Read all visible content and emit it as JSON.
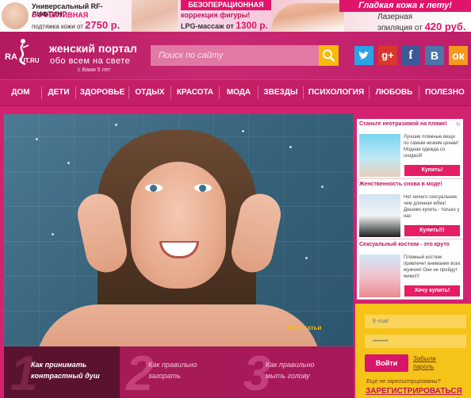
{
  "banners": [
    {
      "line1": "Универсальный RF-ЛИФТИНГ",
      "line2": "ЭФФЕКТИВНАЯ",
      "line3_prefix": "подтяжка кожи от",
      "price": "2750 р."
    },
    {
      "header": "БЕЗОПЕРАЦИОННАЯ",
      "line2": "коррекция фигуры!",
      "line3_prefix": "LPG-массаж от",
      "price": "1300 р."
    },
    {
      "header": "Гладкая кожа к лету!",
      "line2": "Лазерная",
      "line3_prefix": "эпиляция от",
      "price": "420 руб."
    }
  ],
  "header": {
    "logo_left": "RA",
    "logo_right": "UT.RU",
    "title": "женский портал",
    "subtitle": "обо всем на свете",
    "since": "с Вами 5 лет"
  },
  "search": {
    "placeholder": "Поиск по сайту"
  },
  "social": [
    {
      "name": "twitter",
      "glyph": ""
    },
    {
      "name": "google-plus",
      "glyph": "g+"
    },
    {
      "name": "facebook",
      "glyph": "f"
    },
    {
      "name": "vkontakte",
      "glyph": "B"
    },
    {
      "name": "odnoklassniki",
      "glyph": "ок"
    }
  ],
  "nav": [
    "ДОМ",
    "ДЕТИ",
    "ЗДОРОВЬЕ",
    "ОТДЫХ",
    "КРАСОТА",
    "МОДА",
    "ЗВЕЗДЫ",
    "ПСИХОЛОГИЯ",
    "ЛЮБОВЬ",
    "ПОЛЕЗНО"
  ],
  "hero": {
    "caption": "Все статьи"
  },
  "slider_tabs": [
    {
      "num": "1",
      "label": "Как принимать контрастный душ"
    },
    {
      "num": "2",
      "label": "Как правильно загорать"
    },
    {
      "num": "3",
      "label": "Как правильно мыть голову"
    }
  ],
  "ads": [
    {
      "title": "Станьте неотразимой на пляже!",
      "text": "Лучшие пляжные вещи по самым низким ценам! Модная одежда со скидкой!",
      "button": "Купить!"
    },
    {
      "title": "Женственность снова в моде!",
      "text": "Нет ничего сексуальнее, чем длинная юбка! Дешево купить - только у нас",
      "button": "Купить!!!"
    },
    {
      "title": "Сексуальный костюм - это круто",
      "text": "Пляжный костюм привлечет внимание всех мужчин! Они не пройдут мимо!!!",
      "button": "Хочу купить!"
    }
  ],
  "login": {
    "email_placeholder": "E-mail",
    "password_placeholder": "••••••••",
    "button": "Войти",
    "forgot": "Забыли пароль",
    "no_reg": "Еще не зарегистрированы?",
    "register": "ЗАРЕГИСТРИРОВАТЬСЯ"
  },
  "colors": {
    "brand": "#c41e66",
    "accent": "#f7b90a",
    "cta": "#e51d65"
  }
}
